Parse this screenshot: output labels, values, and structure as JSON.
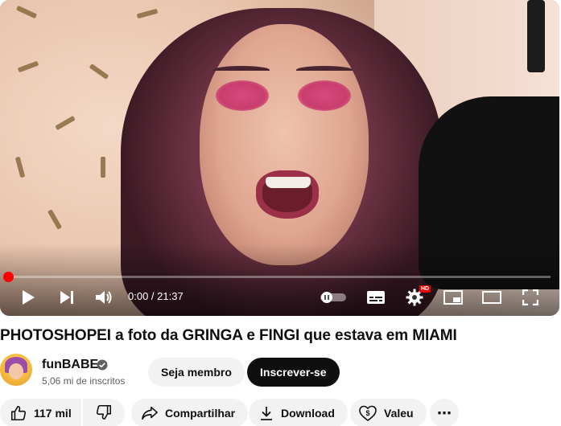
{
  "player": {
    "current_time": "0:00",
    "duration": "21:37",
    "time_display": "0:00 / 21:37",
    "progress_fraction": 0.005,
    "hd_badge": "HD",
    "accent_color": "#ff0000"
  },
  "controls": {
    "play": "play-icon",
    "next": "next-icon",
    "volume": "volume-icon",
    "autoplay": "autoplay-toggle-icon",
    "subtitles": "subtitles-icon",
    "settings": "gear-icon",
    "miniplayer": "miniplayer-icon",
    "theater": "theater-mode-icon",
    "fullscreen": "fullscreen-icon"
  },
  "video": {
    "title": "PHOTOSHOPEI a foto da GRINGA e FINGI que estava em MIAMI"
  },
  "channel": {
    "name": "funBABE",
    "subscribers": "5,06 mi de inscritos",
    "verified_icon": "verified-check-icon",
    "join_label": "Seja membro",
    "subscribe_label": "Inscrever-se"
  },
  "actions": {
    "like_count": "117 mil",
    "share_label": "Compartilhar",
    "download_label": "Download",
    "thanks_label": "Valeu",
    "more_label": "⋯"
  }
}
